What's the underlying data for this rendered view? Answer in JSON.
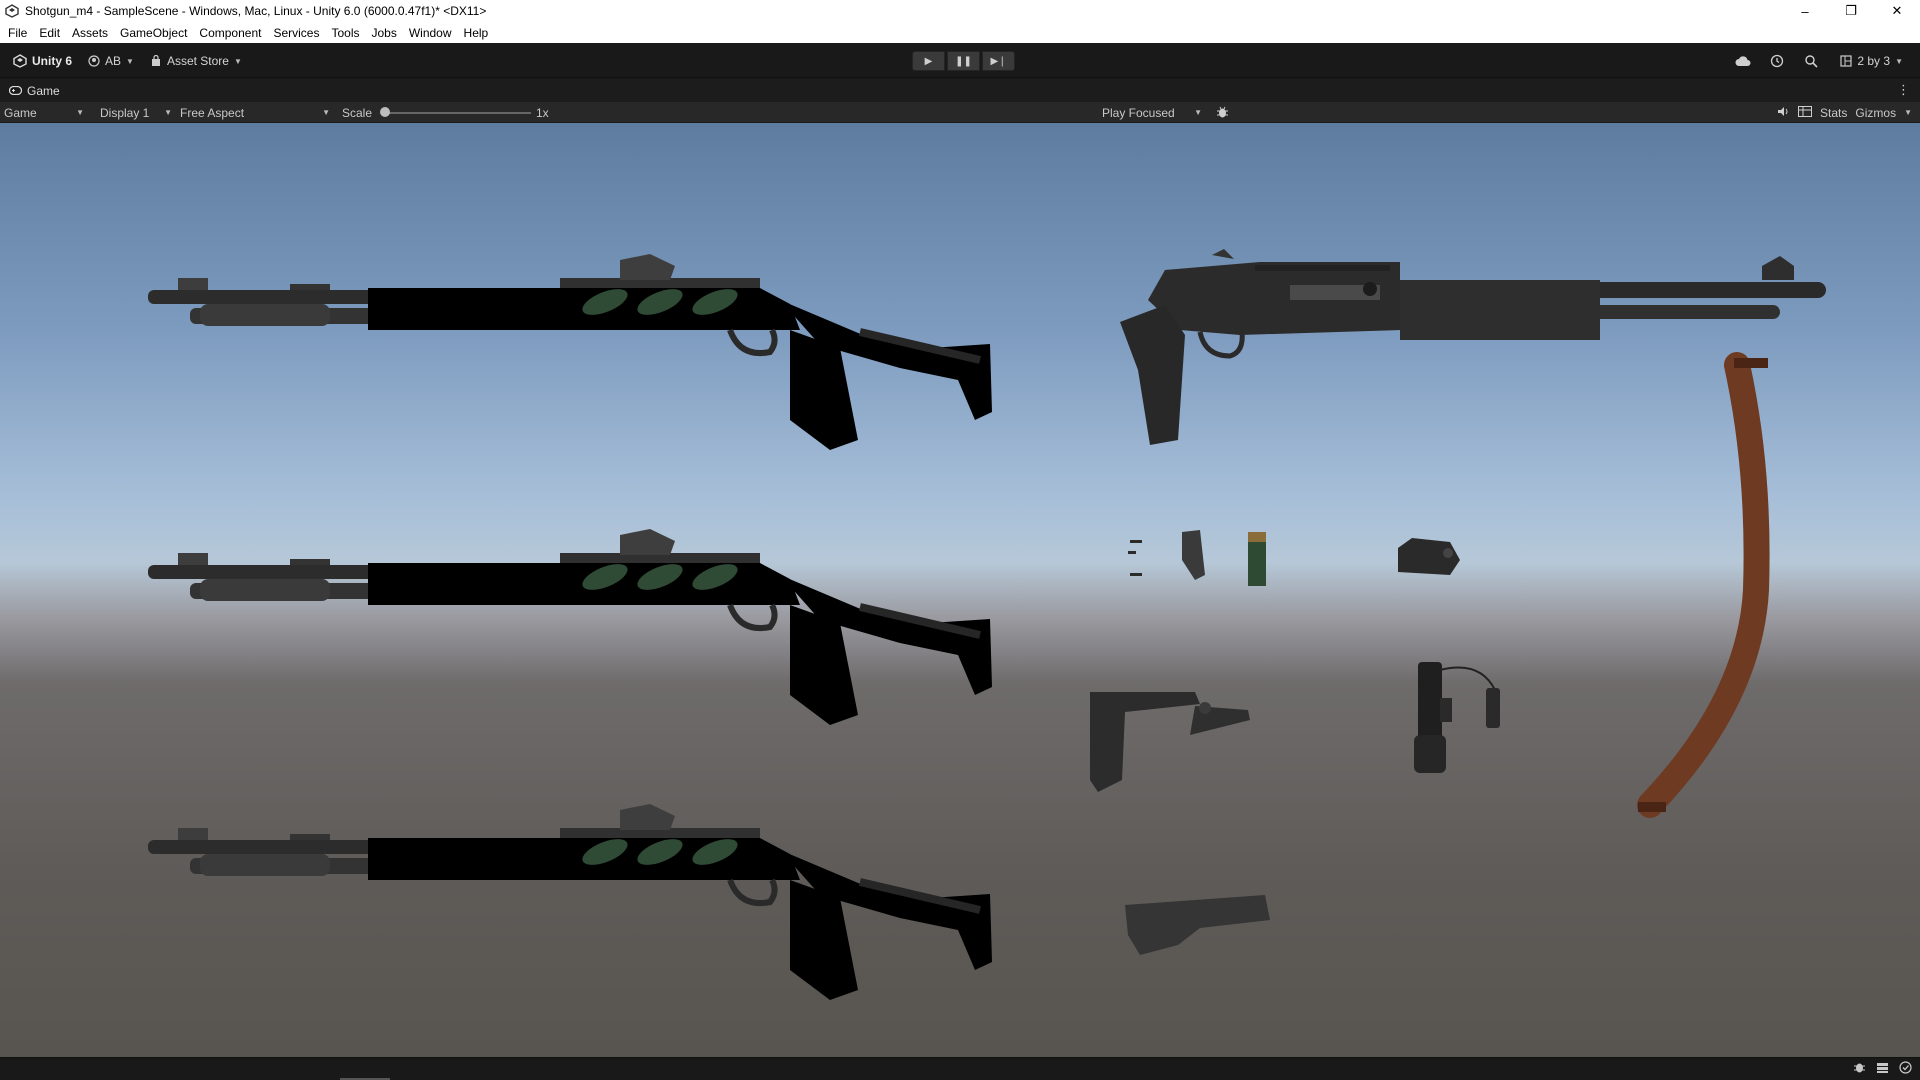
{
  "window": {
    "title": "Shotgun_m4 - SampleScene - Windows, Mac, Linux - Unity 6.0 (6000.0.47f1)* <DX11>",
    "controls": {
      "minimize": "–",
      "restore": "❐",
      "close": "✕"
    }
  },
  "menu": [
    "File",
    "Edit",
    "Assets",
    "GameObject",
    "Component",
    "Services",
    "Tools",
    "Jobs",
    "Window",
    "Help"
  ],
  "toolbar": {
    "unity_label": "Unity 6",
    "account_label": "AB",
    "asset_store_label": "Asset Store",
    "layout_label": "2 by 3",
    "play_icon": "▶",
    "pause_icon": "❚❚",
    "step_icon": "▶❘"
  },
  "game_tab": {
    "label": "Game",
    "menu_icon": "⋮"
  },
  "game_toolbar": {
    "mode": "Game",
    "display": "Display 1",
    "aspect": "Free Aspect",
    "scale_label": "Scale",
    "scale_value": "1x",
    "play_mode": "Play Focused",
    "stats_label": "Stats",
    "gizmos_label": "Gizmos"
  },
  "colors": {
    "editor_dark": "#191919",
    "toolbar": "#282828",
    "sky_top": "#5e7ba0",
    "ground": "#5f5b58",
    "camo_snow": "#c8c8c8",
    "camo_desert": "#c9a67c",
    "camo_woodland": "#6b6248",
    "leather_sling": "#6e3a22"
  },
  "icons": [
    "unity-logo-icon",
    "account-icon",
    "asset-store-icon",
    "cloud-icon",
    "history-icon",
    "search-icon",
    "layout-icon",
    "gamepad-icon",
    "bug-icon",
    "audio-icon",
    "grid-icon"
  ]
}
